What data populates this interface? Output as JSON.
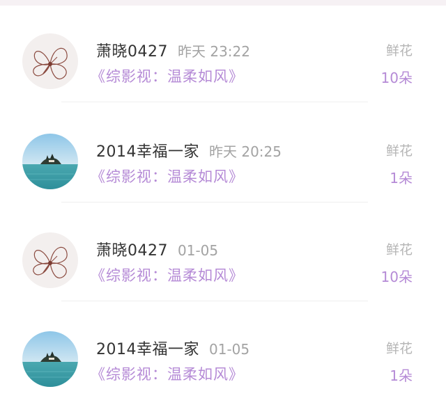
{
  "gifts": [
    {
      "username": "萧晓0427",
      "time": "昨天 23:22",
      "show_title": "《综影视：温柔如风》",
      "gift_label": "鲜花",
      "gift_count": "10朵",
      "avatar": "flower-avatar-icon"
    },
    {
      "username": "2014幸福一家",
      "time": "昨天 20:25",
      "show_title": "《综影视：温柔如风》",
      "gift_label": "鲜花",
      "gift_count": "1朵",
      "avatar": "island-avatar-icon"
    },
    {
      "username": "萧晓0427",
      "time": "01-05",
      "show_title": "《综影视：温柔如风》",
      "gift_label": "鲜花",
      "gift_count": "10朵",
      "avatar": "flower-avatar-icon"
    },
    {
      "username": "2014幸福一家",
      "time": "01-05",
      "show_title": "《综影视：温柔如风》",
      "gift_label": "鲜花",
      "gift_count": "1朵",
      "avatar": "island-avatar-icon"
    }
  ],
  "colors": {
    "accent": "#b58ad6",
    "muted": "#a3a3a3",
    "name": "#333333"
  }
}
